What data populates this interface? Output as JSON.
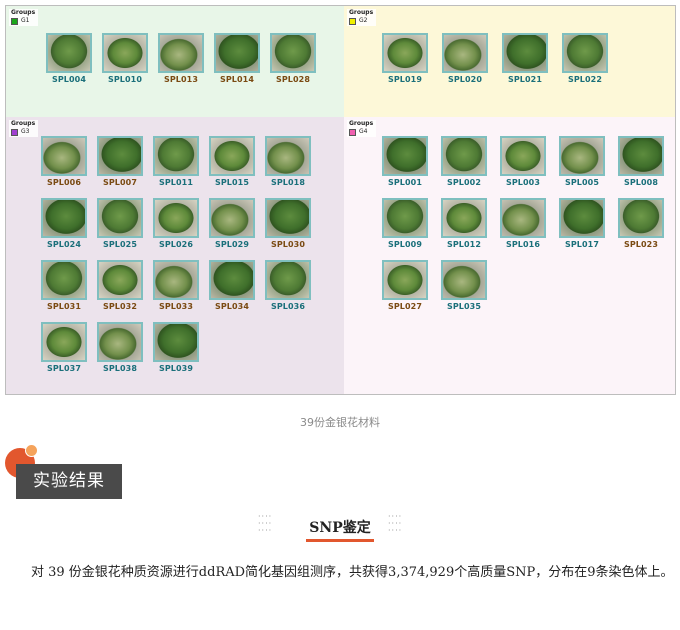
{
  "figure": {
    "legend_title": "Groups",
    "groups": [
      {
        "id": "G1",
        "color": "#1aa61a",
        "samples": [
          "SPL004",
          "SPL010",
          "SPL013",
          "SPL014",
          "SPL028"
        ],
        "label_colors": [
          "teal",
          "teal",
          "brown",
          "brown",
          "brown"
        ]
      },
      {
        "id": "G2",
        "color": "#f0f000",
        "samples": [
          "SPL019",
          "SPL020",
          "SPL021",
          "SPL022"
        ],
        "label_colors": [
          "teal",
          "teal",
          "teal",
          "teal"
        ]
      },
      {
        "id": "G3",
        "color": "#a040d0",
        "samples": [
          "SPL006",
          "SPL007",
          "SPL011",
          "SPL015",
          "SPL018",
          "SPL024",
          "SPL025",
          "SPL026",
          "SPL029",
          "SPL030",
          "SPL031",
          "SPL032",
          "SPL033",
          "SPL034",
          "SPL036",
          "SPL037",
          "SPL038",
          "SPL039"
        ],
        "label_colors": [
          "brown",
          "brown",
          "teal",
          "teal",
          "teal",
          "teal",
          "teal",
          "teal",
          "teal",
          "brown",
          "brown",
          "brown",
          "brown",
          "brown",
          "teal",
          "teal",
          "teal",
          "teal"
        ]
      },
      {
        "id": "G4",
        "color": "#f060b0",
        "samples": [
          "SPL001",
          "SPL002",
          "SPL003",
          "SPL005",
          "SPL008",
          "SPL009",
          "SPL012",
          "SPL016",
          "SPL017",
          "SPL023",
          "SPL027",
          "SPL035"
        ],
        "label_colors": [
          "teal",
          "teal",
          "teal",
          "teal",
          "teal",
          "teal",
          "teal",
          "teal",
          "teal",
          "brown",
          "brown",
          "teal"
        ]
      }
    ]
  },
  "caption": "39份金银花材料",
  "section_badge": "实验结果",
  "subsection_title": "SNP鉴定",
  "paragraph": "对 39 份金银花种质资源进行ddRAD简化基因组测序，共获得3,374,929个高质量SNP，分布在9条染色体上。"
}
